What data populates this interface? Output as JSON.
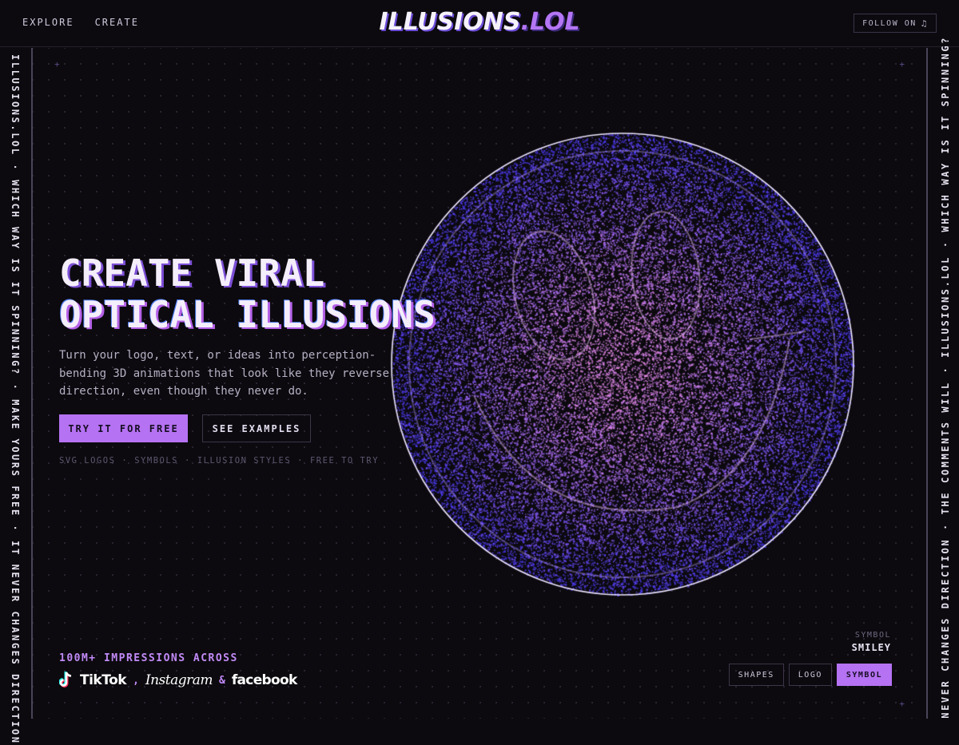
{
  "nav": {
    "links": [
      "EXPLORE",
      "CREATE"
    ],
    "logo_main": "ILLUSIONS",
    "logo_tld": ".LOL",
    "follow_label": "FOLLOW ON",
    "follow_icon": "tiktok-icon"
  },
  "rails": {
    "left": "ILLUSIONS.LOL · WHICH WAY IS IT SPINNING? · MAKE YOURS FREE · IT NEVER CHANGES DIRECTION",
    "right": "NEVER CHANGES DIRECTION · THE COMMENTS WILL · ILLUSIONS.LOL · WHICH WAY IS IT SPINNING?"
  },
  "hero": {
    "line1": "CREATE VIRAL",
    "line2": "OPTICAL ILLUSIONS",
    "description": "Turn your logo, text, or ideas into perception-bending 3D animations that look like they reverse direction, even though they never do.",
    "primary_cta": "TRY IT FOR FREE",
    "secondary_cta": "SEE EXAMPLES",
    "features": [
      "SVG LOGOS",
      "SYMBOLS",
      "ILLUSION STYLES",
      "FREE TO TRY"
    ]
  },
  "social": {
    "impressions": "100M+ IMPRESSIONS ACROSS",
    "platforms": [
      "TikTok",
      "Instagram",
      "facebook"
    ],
    "joiner_comma": ",",
    "joiner_and": "&"
  },
  "selector": {
    "caption_label": "SYMBOL",
    "caption_value": "SMILEY",
    "modes": [
      "SHAPES",
      "LOGO",
      "SYMBOL"
    ],
    "active_mode": "SYMBOL"
  },
  "colors": {
    "accent": "#b572f2",
    "background": "#0c0a0f",
    "orb_outer": "#4a3bea",
    "orb_inner": "#e07be8"
  }
}
